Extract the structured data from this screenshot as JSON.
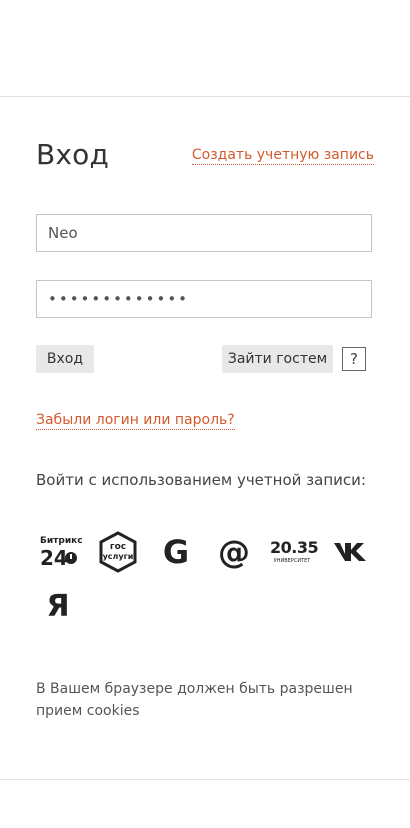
{
  "header": {},
  "auth": {
    "title": "Вход",
    "create_account_link": "Создать учетную запись",
    "login_value": "Neo",
    "password_value": "•••••••••••••",
    "login_button": "Вход",
    "guest_button": "Зайти гостем",
    "help_label": "?",
    "forgot_link": "Забыли логин или пароль?",
    "social_caption": "Войти с использованием учетной записи:",
    "social": {
      "bitrix_name": "Битрикс",
      "bitrix_number": "24",
      "gosuslugi_line1": "гос",
      "gosuslugi_line2": "услуги",
      "google_letter": "G",
      "mail_symbol": "@",
      "uni_number": "20.35",
      "uni_text": "УНИВЕРСИТЕТ",
      "yandex_letter": "Я",
      "icons": [
        "bitrix24-icon",
        "gosuslugi-icon",
        "google-icon",
        "mailru-icon",
        "university-2035-icon",
        "vk-icon",
        "yandex-icon"
      ]
    },
    "cookie_note": "В Вашем браузере должен быть разрешен прием cookies"
  },
  "colors": {
    "link": "#d35a2e",
    "button_bg": "#e8e8e8",
    "border": "#c4c4c4",
    "divider": "#e2e2e2"
  }
}
